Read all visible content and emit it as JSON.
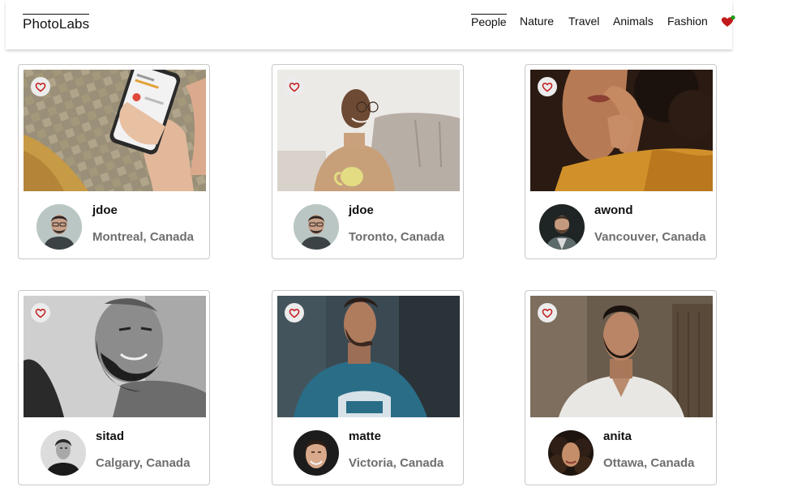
{
  "app": {
    "title": "PhotoLabs"
  },
  "nav": {
    "items": [
      {
        "label": "People",
        "active": true
      },
      {
        "label": "Nature",
        "active": false
      },
      {
        "label": "Travel",
        "active": false
      },
      {
        "label": "Animals",
        "active": false
      },
      {
        "label": "Fashion",
        "active": false
      }
    ],
    "favourites_icon": "heart-with-notification-dot",
    "notification_color": "#1a9c1a",
    "heart_color": "#c21a1a"
  },
  "photos": [
    {
      "username": "jdoe",
      "location": "Montreal, Canada",
      "subject": "hand-holding-phone"
    },
    {
      "username": "jdoe",
      "location": "Toronto, Canada",
      "subject": "man-with-mug"
    },
    {
      "username": "awond",
      "location": "Vancouver, Canada",
      "subject": "woman-curly-hair"
    },
    {
      "username": "sitad",
      "location": "Calgary, Canada",
      "subject": "bearded-man-bw"
    },
    {
      "username": "matte",
      "location": "Victoria, Canada",
      "subject": "man-blue-shirt"
    },
    {
      "username": "anita",
      "location": "Ottawa, Canada",
      "subject": "bearded-man-white-shirt"
    }
  ]
}
